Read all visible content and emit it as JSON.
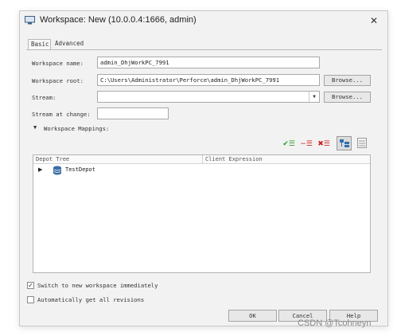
{
  "dialog": {
    "title": "Workspace: New (10.0.0.4:1666,  admin)",
    "close_glyph": "✕"
  },
  "tabs": [
    {
      "label": "Basic",
      "active": true
    },
    {
      "label": "Advanced",
      "active": false
    }
  ],
  "form": {
    "workspace_name_label": "Workspace name:",
    "workspace_name_value": "admin_DhjWorkPC_7991",
    "workspace_root_label": "Workspace root:",
    "workspace_root_value": "C:\\Users\\Administrator\\Perforce\\admin_DhjWorkPC_7991",
    "browse_label": "Browse...",
    "stream_label": "Stream:",
    "stream_value": "",
    "stream_at_change_label": "Stream at change:",
    "stream_at_change_value": "",
    "mappings_label": "Workspace Mappings:"
  },
  "mappings_toolbar": {
    "include_icon": "✔☰",
    "exclude_icon": "−☰",
    "clear_icon": "✖☰"
  },
  "tree": {
    "columns": [
      "Depot Tree",
      "Client Expression"
    ],
    "rows": [
      {
        "label": "TestDepot",
        "expression": ""
      }
    ]
  },
  "options": {
    "switch_label": "Switch to new workspace immediately",
    "switch_checked": true,
    "auto_get_label": "Automatically get all revisions",
    "auto_get_checked": false
  },
  "buttons": {
    "ok": "OK",
    "cancel": "Cancel",
    "help": "Help"
  },
  "watermark": "CSDN @Tcohneyn",
  "colors": {
    "include": "#2e9b2e",
    "exclude": "#d02020",
    "clear": "#d02020",
    "tree_view_active": "#2f6fb0",
    "depot_icon": "#3a6ea5"
  }
}
